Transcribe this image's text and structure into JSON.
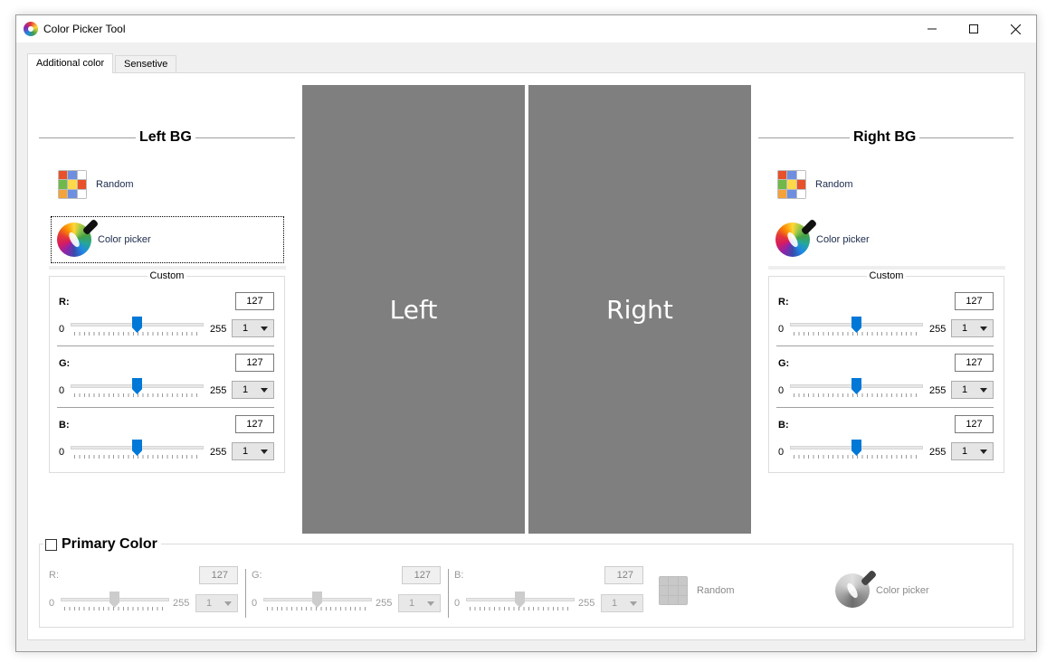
{
  "window": {
    "title": "Color Picker Tool"
  },
  "tabs": [
    {
      "label": "Additional color"
    },
    {
      "label": "Sensetive"
    }
  ],
  "left": {
    "title": "Left BG",
    "random_label": "Random",
    "picker_label": "Color picker",
    "custom_legend": "Custom",
    "channels": [
      {
        "label": "R:",
        "value": "127",
        "min": "0",
        "max": "255",
        "step": "1",
        "level": 127
      },
      {
        "label": "G:",
        "value": "127",
        "min": "0",
        "max": "255",
        "step": "1",
        "level": 127
      },
      {
        "label": "B:",
        "value": "127",
        "min": "0",
        "max": "255",
        "step": "1",
        "level": 127
      }
    ]
  },
  "right": {
    "title": "Right BG",
    "random_label": "Random",
    "picker_label": "Color picker",
    "custom_legend": "Custom",
    "channels": [
      {
        "label": "R:",
        "value": "127",
        "min": "0",
        "max": "255",
        "step": "1",
        "level": 127
      },
      {
        "label": "G:",
        "value": "127",
        "min": "0",
        "max": "255",
        "step": "1",
        "level": 127
      },
      {
        "label": "B:",
        "value": "127",
        "min": "0",
        "max": "255",
        "step": "1",
        "level": 127
      }
    ]
  },
  "preview": {
    "left_label": "Left",
    "right_label": "Right",
    "color": "#7f7f7f"
  },
  "primary": {
    "title": "Primary Color",
    "checked": false,
    "channels": [
      {
        "label": "R:",
        "value": "127",
        "min": "0",
        "max": "255",
        "step": "1",
        "level": 127
      },
      {
        "label": "G:",
        "value": "127",
        "min": "0",
        "max": "255",
        "step": "1",
        "level": 127
      },
      {
        "label": "B:",
        "value": "127",
        "min": "0",
        "max": "255",
        "step": "1",
        "level": 127
      }
    ],
    "random_label": "Random",
    "picker_label": "Color picker"
  },
  "colors": {
    "accent": "#0078d7",
    "preview_gray": "#7f7f7f",
    "random_grid": [
      "#e8512a",
      "#6e8fe0",
      "#ffffff",
      "#6fb84a",
      "#ffd94a",
      "#e8512a",
      "#f4a23a",
      "#6e8fe0",
      "#ffffff"
    ]
  }
}
